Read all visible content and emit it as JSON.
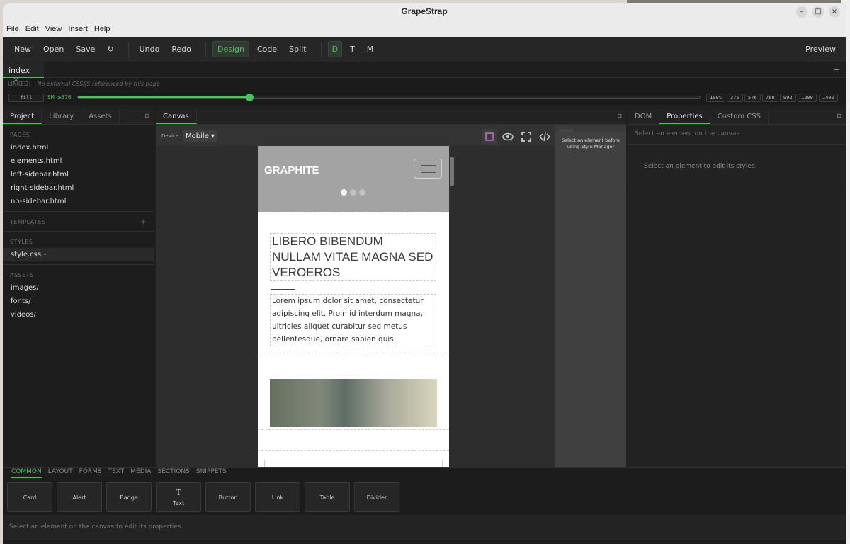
{
  "window": {
    "title": "GrapeStrap"
  },
  "menu": [
    "File",
    "Edit",
    "View",
    "Insert",
    "Help"
  ],
  "toolbar": {
    "new": "New",
    "open": "Open",
    "save": "Save",
    "refresh_glyph": "↻",
    "undo": "Undo",
    "redo": "Redo",
    "design": "Design",
    "code": "Code",
    "split": "Split",
    "d": "D",
    "t": "T",
    "m": "M",
    "preview": "Preview"
  },
  "doc_tab": {
    "label": "index",
    "close": "×",
    "add": "+"
  },
  "linked": {
    "label": "LINKED:",
    "text": "No external CSS/JS referenced by this page"
  },
  "responsive": {
    "fill": "fill",
    "breakpoint": "SM ≥576",
    "progress_fraction": 0.276,
    "sizes": [
      "100%",
      "375",
      "576",
      "768",
      "992",
      "1200",
      "1400"
    ]
  },
  "left_panel": {
    "tabs": [
      "Project",
      "Library",
      "Assets"
    ],
    "pages_label": "PAGES",
    "pages": [
      "index.html",
      "elements.html",
      "left-sidebar.html",
      "right-sidebar.html",
      "no-sidebar.html"
    ],
    "templates_label": "TEMPLATES",
    "templates_add": "+",
    "styles_label": "STYLES",
    "styles_file": "style.css",
    "styles_dot": "•",
    "assets_label": "ASSETS",
    "assets": [
      "images/",
      "fonts/",
      "videos/"
    ]
  },
  "canvas": {
    "tab": "Canvas",
    "device_label": "Device",
    "device_value": "Mobile ▾",
    "brand": "GRAPHITE",
    "heading": "LIBERO BIBENDUM NULLAM VITAE MAGNA SED VEROEROS",
    "body": "Lorem ipsum dolor sit amet, consectetur adipiscing elit. Proin id interdum magna, ultricies aliquet curabitur sed metus pellentesque, ornare sapien quis.",
    "style_manager_hint": "Select an element before using Style Manager"
  },
  "right_panel": {
    "tabs": [
      "DOM",
      "Properties",
      "Custom CSS"
    ],
    "hint_top": "Select an element on the canvas.",
    "hint_styles": "Select an element to edit its styles."
  },
  "bottom": {
    "tabs": [
      "COMMON",
      "LAYOUT",
      "FORMS",
      "TEXT",
      "MEDIA",
      "SECTIONS",
      "SNIPPETS"
    ],
    "blocks": [
      "Card",
      "Alert",
      "Badge",
      "Text",
      "Button",
      "Link",
      "Table",
      "Divider"
    ],
    "text_glyph": "T",
    "status": "Select an element on the canvas to edit its properties."
  },
  "colors": {
    "accent": "#4cc15d",
    "panel": "#1f1f1f",
    "hero": "#a3a3a3"
  }
}
